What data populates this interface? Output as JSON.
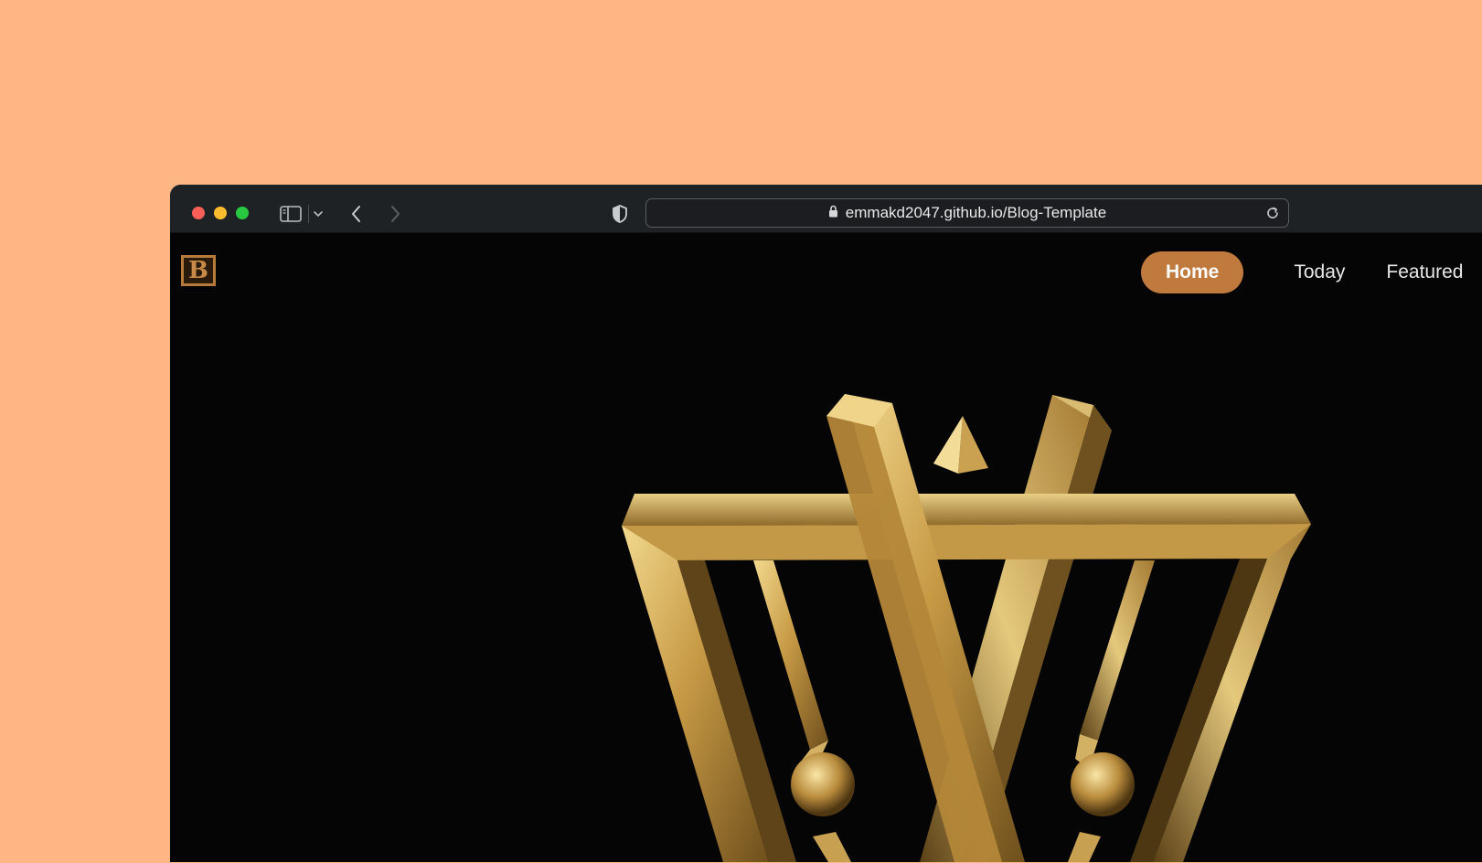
{
  "browser": {
    "url": "emmakd2047.github.io/Blog-Template"
  },
  "site": {
    "logo_letter": "B",
    "nav": [
      {
        "label": "Home",
        "active": true
      },
      {
        "label": "Today",
        "active": false
      },
      {
        "label": "Featured",
        "active": false
      }
    ]
  },
  "colors": {
    "background": "#FFB685",
    "accent": "#C07A3E",
    "page": "#050505",
    "gold": "#D9B45E"
  },
  "icons": [
    "sidebar-icon",
    "chevron-down-icon",
    "back-arrow-icon",
    "forward-arrow-icon",
    "privacy-shield-icon",
    "lock-icon",
    "reload-icon"
  ]
}
